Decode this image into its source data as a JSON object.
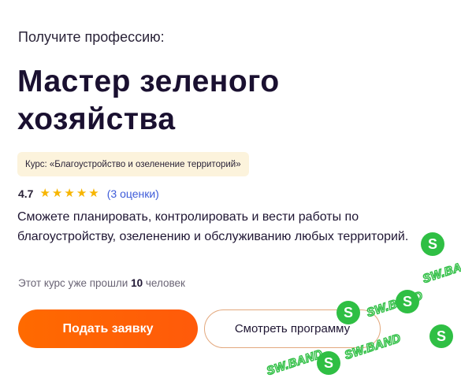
{
  "header": {
    "eyebrow": "Получите профессию:",
    "title": "Мастер зеленого хозяйства"
  },
  "course_badge": {
    "text": "Курс: «Благоустройство и озеленение территорий»"
  },
  "rating": {
    "score": "4.7",
    "stars": 5,
    "reviews": "(3 оценки)"
  },
  "description": "Сможете планировать, контролировать и вести работы по благоустройству, озеленению и обслуживанию любых территорий.",
  "passed": {
    "prefix": "Этот курс уже прошли ",
    "count": "10",
    "suffix": " человек"
  },
  "actions": {
    "primary": "Подать заявку",
    "secondary": "Смотреть программу"
  },
  "watermark": {
    "text": "SW.BAND",
    "glyph": "S"
  },
  "colors": {
    "accent": "#ff6a00",
    "star": "#f7b500",
    "link": "#3d5bd9",
    "badge_bg": "#fcf3dc",
    "watermark": "#2fbf44"
  }
}
